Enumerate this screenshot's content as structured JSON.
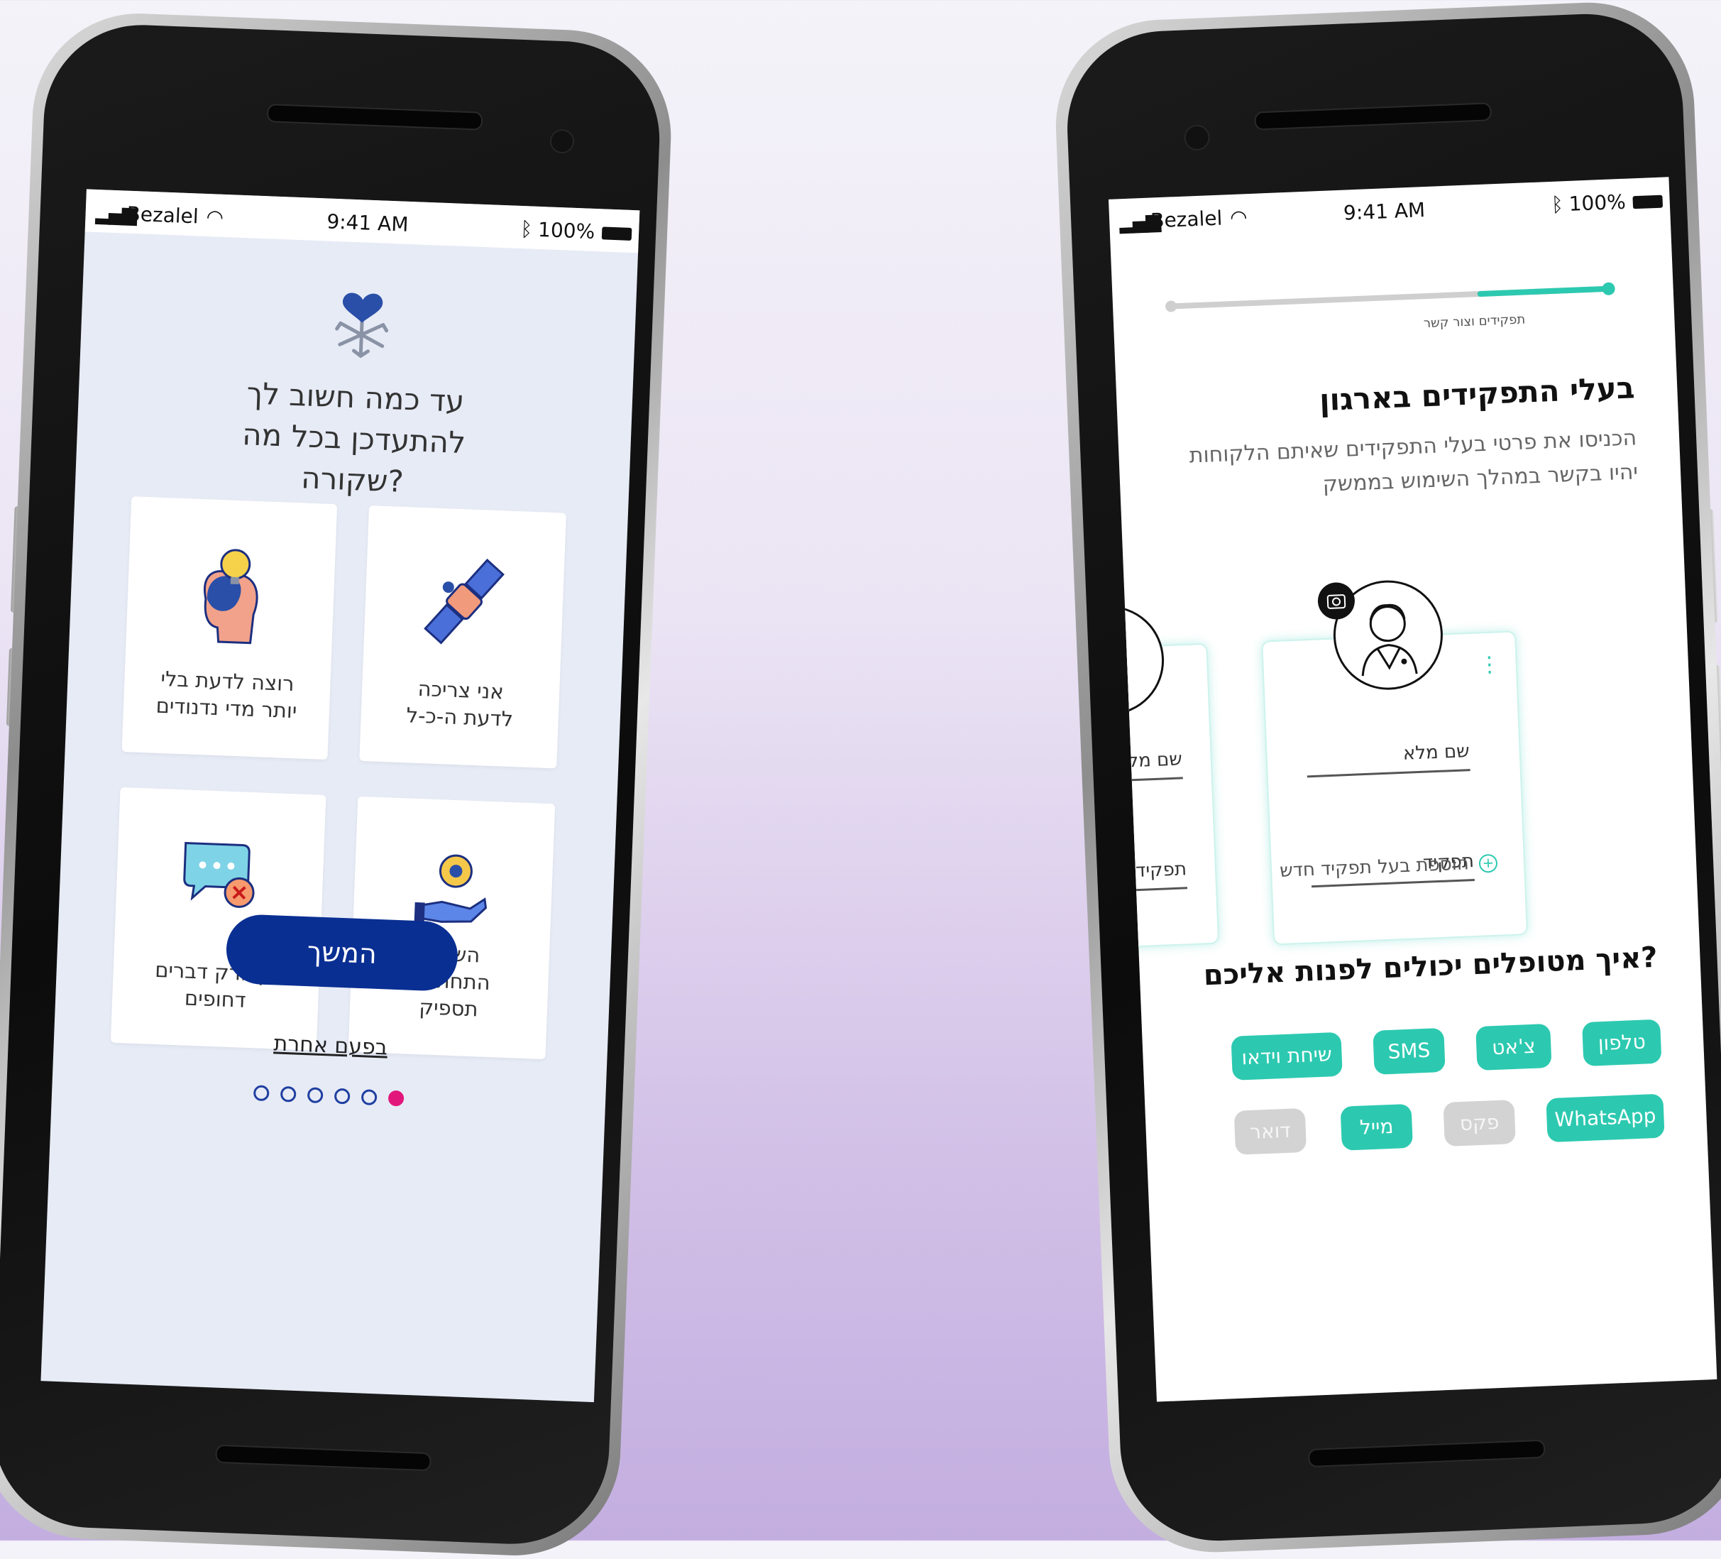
{
  "left_phone": {
    "status": {
      "carrier": "Bezalel",
      "time": "9:41 AM",
      "battery": "100%"
    },
    "logo_icon": "heart-snowflake-logo-icon",
    "question": "עד כמה חשוב לך להתעדכן בכל מה שקורה?",
    "cards": [
      {
        "label": "אני צריכה לדעת ה-כ-ל",
        "icon": "satellite-icon"
      },
      {
        "label": "רוצה לדעת בלי יותר מדי נדנודים",
        "icon": "head-lightbulb-icon"
      },
      {
        "label": "השורה התחתונה תספיק",
        "icon": "hand-gear-icon"
      },
      {
        "label": "אך ורק דברים דחופים",
        "icon": "chat-bubble-x-icon"
      }
    ],
    "continue_label": "המשך",
    "later_label": "בפעם אחרת",
    "pagination": {
      "total": 6,
      "active_index": 5
    },
    "colors": {
      "primary": "#0a2f93",
      "accent": "#e2177c",
      "bg": "#e7ebf6"
    }
  },
  "right_phone": {
    "status": {
      "carrier": "Bezalel",
      "time": "9:41 AM",
      "battery": "100%"
    },
    "progress": {
      "label": "תפקידים וצור קשר",
      "value": 0.3
    },
    "title": "בעלי התפקידים בארגון",
    "subtitle": "הכניסו את פרטי בעלי התפקידים שאיתם הלקוחות יהיו בקשר במהלך השימוש בממשק",
    "role_card": {
      "name_label": "שם מלא",
      "role_label": "תפקיד",
      "avatar_icon": "doctor-avatar-icon",
      "camera_icon": "camera-icon",
      "menu_icon": "more-vertical-icon"
    },
    "partial_card": {
      "name_label": "שם מלא",
      "role_label": "תפקיד"
    },
    "add_role_label": "הוספת בעל תפקיד חדש",
    "contact_title": "איך מטופלים יכולים לפנות אליכם?",
    "chips": [
      {
        "label": "טלפון",
        "active": true
      },
      {
        "label": "צ'אט",
        "active": true
      },
      {
        "label": "SMS",
        "active": true
      },
      {
        "label": "שיחת וידאו",
        "active": true
      },
      {
        "label": "WhatsApp",
        "active": true
      },
      {
        "label": "פקס",
        "active": false
      },
      {
        "label": "מייל",
        "active": true
      },
      {
        "label": "דואר",
        "active": false
      }
    ],
    "colors": {
      "accent": "#2cc9b0",
      "inactive": "#d3d3d3"
    }
  }
}
